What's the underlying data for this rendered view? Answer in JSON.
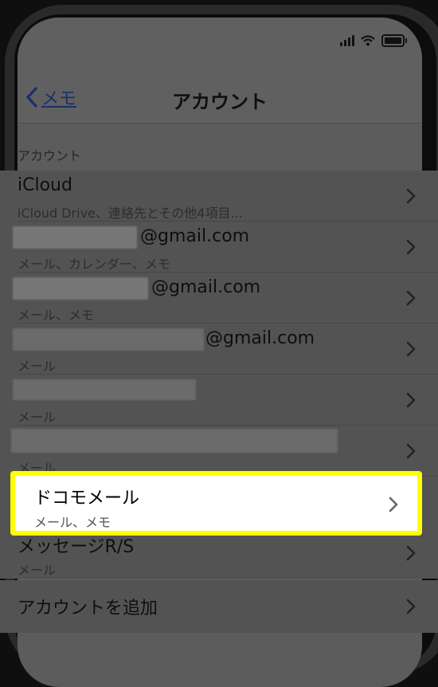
{
  "nav": {
    "back_label": "メモ",
    "title": "アカウント"
  },
  "section_header": "アカウント",
  "accounts": [
    {
      "title": "iCloud",
      "subtitle": "iCloud Drive、連絡先とその他4項目..."
    },
    {
      "title": "@gmail.com",
      "subtitle": "メール、カレンダー、メモ"
    },
    {
      "title": "@gmail.com",
      "subtitle": "メール、メモ"
    },
    {
      "title": "@gmail.com",
      "subtitle": "メール"
    },
    {
      "title": "",
      "subtitle": "メール"
    },
    {
      "title": "",
      "subtitle": "メール"
    },
    {
      "title": "ドコモメール",
      "subtitle": "メール、メモ",
      "highlighted": true
    },
    {
      "title": "メッセージR/S",
      "subtitle": "メール"
    }
  ],
  "add_account": "アカウントを追加",
  "colors": {
    "highlight": "#ffff00",
    "back_tint": "#1b2f6b"
  },
  "icons": {
    "back": "chevron-left-icon",
    "row": "chevron-right-icon",
    "status": [
      "signal-icon",
      "wifi-icon",
      "battery-icon"
    ]
  }
}
